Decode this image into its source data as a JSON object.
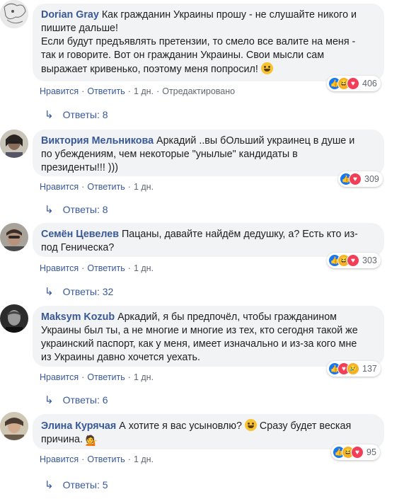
{
  "comments": [
    {
      "author": "Dorian Gray",
      "text_lines": [
        "Как гражданин Украины прошу - не слушайте никого и",
        "пишите дальше!",
        "Если будут предъявлять претензии, то смело все валите на меня -",
        "так и говорите. Вот он гражданин Украины. Свои мысли сам",
        "выражает кривенько, поэтому меня попросил!"
      ],
      "has_emoji": true,
      "reaction_count": "406",
      "reactions": [
        "like-icon",
        "haha-icon",
        "love-icon"
      ],
      "like": "Нравится",
      "reply": "Ответить",
      "time": "1 дн.",
      "edited": "Отредактировано",
      "replies_label": "Ответы: 8"
    },
    {
      "author": "Виктория Мельникова",
      "text_lines": [
        "Аркадий ..вы бОльший украинец в душе и",
        "по убеждениям, чем некоторые \"унылые\" кандидаты в",
        "президенты!!! )))"
      ],
      "reaction_count": "309",
      "reactions": [
        "like-icon",
        "love-icon"
      ],
      "like": "Нравится",
      "reply": "Ответить",
      "time": "1 дн.",
      "replies_label": "Ответы: 8"
    },
    {
      "author": "Семён Цевелев",
      "text_lines": [
        "Пацаны, давайте найдём дедушку, а? Есть кто из-",
        "под Геническа?"
      ],
      "reaction_count": "303",
      "reactions": [
        "like-icon",
        "haha-icon",
        "love-icon"
      ],
      "like": "Нравится",
      "reply": "Ответить",
      "time": "1 дн.",
      "replies_label": "Ответы: 32"
    },
    {
      "author": "Maksym Kozub",
      "text_lines": [
        "Аркадий, я бы предпочёл, чтобы гражданином",
        "Украины был ты, а не многие и многие из тех, кто сегодня такой же",
        "украинский паспорт, как у меня, имеет изначально и из-за кого мне",
        "из Украины давно хочется уехать."
      ],
      "reaction_count": "137",
      "reactions": [
        "like-icon",
        "love-icon",
        "sad-icon"
      ],
      "like": "Нравится",
      "reply": "Ответить",
      "time": "1 дн.",
      "replies_label": "Ответы: 6"
    },
    {
      "author": "Элина Курячая",
      "text_lines": [
        "А хотите я вас усыновлю?",
        "Сразу будет веская",
        "причина."
      ],
      "reaction_count": "95",
      "reactions": [
        "like-icon",
        "haha-icon",
        "love-icon"
      ],
      "like": "Нравится",
      "reply": "Ответить",
      "time": "1 дн.",
      "replies_label": "Ответы: 5"
    }
  ],
  "colors": {
    "link": "#385898",
    "bubble": "#f2f3f5",
    "meta": "#606770"
  }
}
